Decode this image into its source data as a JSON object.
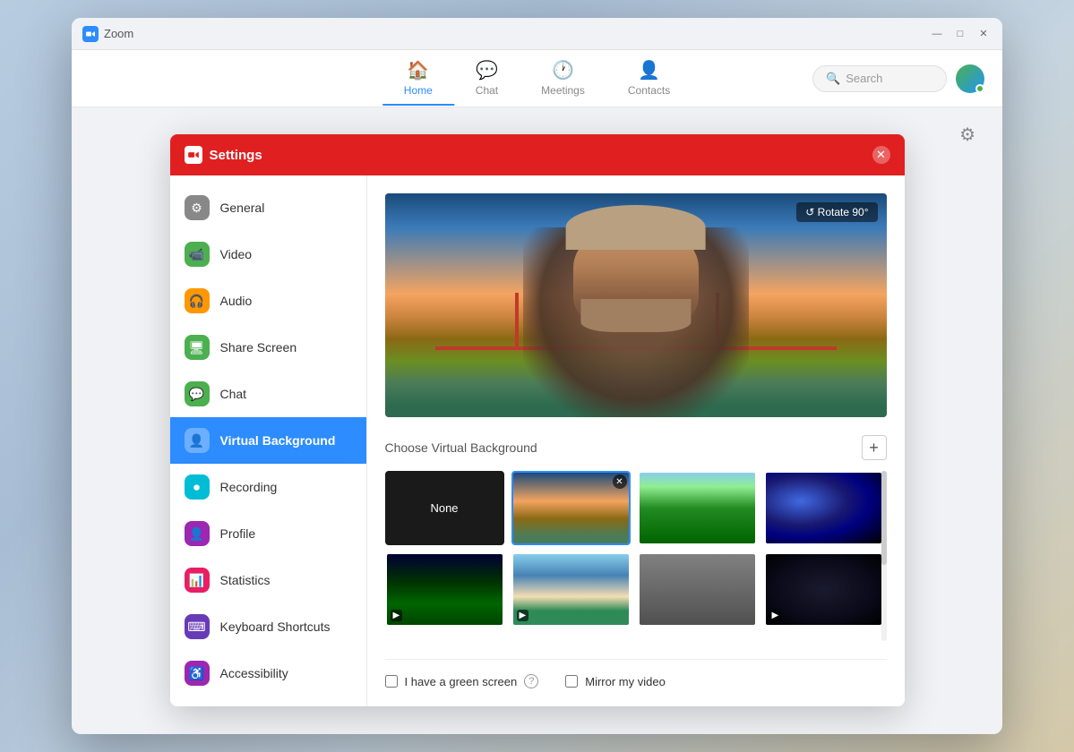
{
  "app": {
    "title": "Zoom"
  },
  "titlebar": {
    "minimize": "—",
    "maximize": "□",
    "close": "✕"
  },
  "nav": {
    "tabs": [
      {
        "id": "home",
        "label": "Home",
        "icon": "🏠",
        "active": true
      },
      {
        "id": "chat",
        "label": "Chat",
        "icon": "💬",
        "active": false
      },
      {
        "id": "meetings",
        "label": "Meetings",
        "icon": "🕐",
        "active": false
      },
      {
        "id": "contacts",
        "label": "Contacts",
        "icon": "👤",
        "active": false
      }
    ],
    "search_placeholder": "Search"
  },
  "settings": {
    "title": "Settings",
    "close_label": "✕",
    "sidebar_items": [
      {
        "id": "general",
        "label": "General",
        "icon": "⚙",
        "bg": "#888",
        "active": false
      },
      {
        "id": "video",
        "label": "Video",
        "icon": "📹",
        "bg": "#4CAF50",
        "active": false
      },
      {
        "id": "audio",
        "label": "Audio",
        "icon": "🎧",
        "bg": "#FF9800",
        "active": false
      },
      {
        "id": "share-screen",
        "label": "Share Screen",
        "icon": "🖥",
        "bg": "#4CAF50",
        "active": false
      },
      {
        "id": "chat",
        "label": "Chat",
        "icon": "💬",
        "bg": "#4CAF50",
        "active": false
      },
      {
        "id": "virtual-background",
        "label": "Virtual Background",
        "icon": "👤",
        "bg": "#2D8CFF",
        "active": true
      },
      {
        "id": "recording",
        "label": "Recording",
        "icon": "⏺",
        "bg": "#00BCD4",
        "active": false
      },
      {
        "id": "profile",
        "label": "Profile",
        "icon": "👤",
        "bg": "#9C27B0",
        "active": false
      },
      {
        "id": "statistics",
        "label": "Statistics",
        "icon": "📊",
        "bg": "#E91E63",
        "active": false
      },
      {
        "id": "keyboard-shortcuts",
        "label": "Keyboard Shortcuts",
        "icon": "⌨",
        "bg": "#673AB7",
        "active": false
      },
      {
        "id": "accessibility",
        "label": "Accessibility",
        "icon": "♿",
        "bg": "#9C27B0",
        "active": false
      }
    ],
    "content": {
      "rotate_label": "↺ Rotate 90°",
      "choose_bg_label": "Choose Virtual Background",
      "add_bg_label": "+",
      "thumbnails": [
        {
          "id": "none",
          "label": "None",
          "type": "none",
          "selected": false
        },
        {
          "id": "golden-gate",
          "label": "Golden Gate",
          "type": "golden-gate",
          "selected": true
        },
        {
          "id": "forest",
          "label": "Forest",
          "type": "forest",
          "selected": false
        },
        {
          "id": "space",
          "label": "Space",
          "type": "space",
          "selected": false
        },
        {
          "id": "aurora",
          "label": "Aurora",
          "type": "aurora",
          "selected": false,
          "has_video": true
        },
        {
          "id": "beach",
          "label": "Beach",
          "type": "beach",
          "selected": false,
          "has_video": true
        },
        {
          "id": "room",
          "label": "Room",
          "type": "room",
          "selected": false
        },
        {
          "id": "stars",
          "label": "Stars",
          "type": "stars",
          "selected": false,
          "has_video": true
        }
      ],
      "green_screen_label": "I have a green screen",
      "mirror_label": "Mirror my video"
    }
  }
}
